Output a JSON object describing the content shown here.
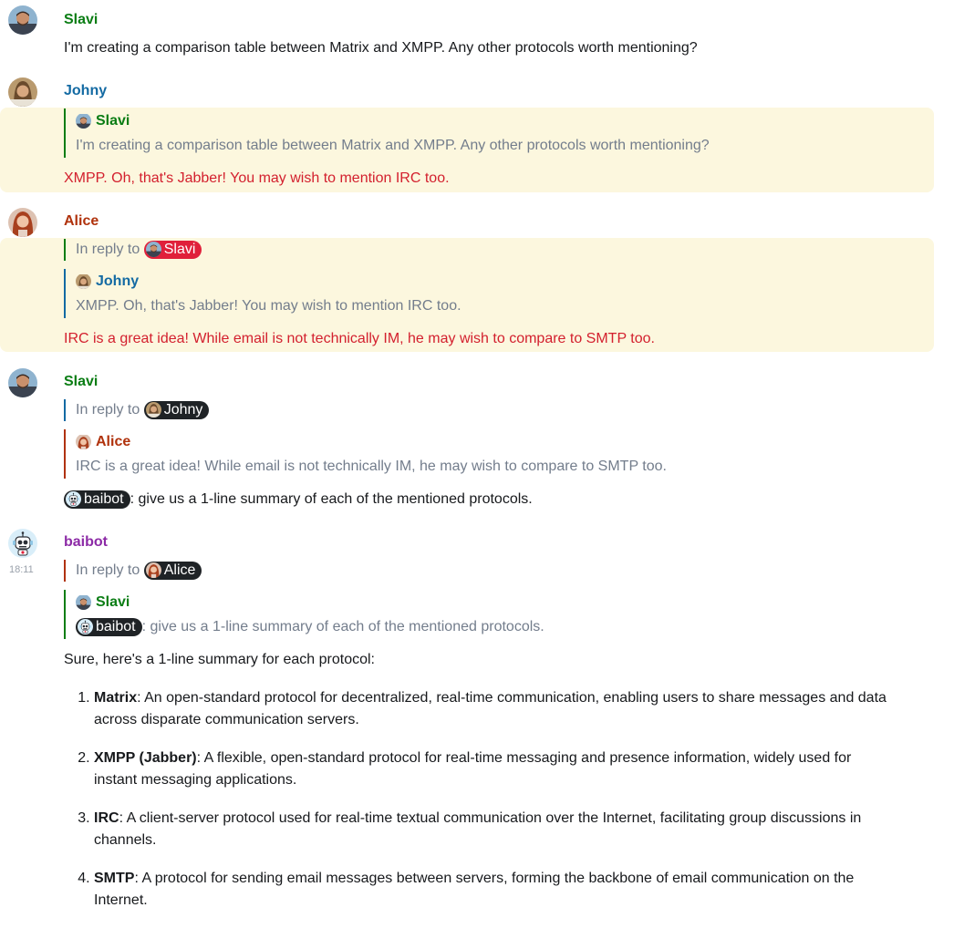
{
  "colors": {
    "highlight_bg": "#fcf7de",
    "mention_text": "#d3202e",
    "slavi": "#0a7d14",
    "johny": "#136aa3",
    "alice": "#b0320c",
    "baibot": "#8c2aa6"
  },
  "labels": {
    "in_reply_to": "In reply to"
  },
  "messages": [
    {
      "sender": "Slavi",
      "avatar": "slavi-avatar",
      "body": "I'm creating a comparison table between Matrix and XMPP. Any other protocols worth mentioning?"
    },
    {
      "sender": "Johny",
      "avatar": "johny-avatar",
      "quote_sender": "Slavi",
      "quote_body": "I'm creating a comparison table between Matrix and XMPP. Any other protocols worth mentioning?",
      "body": "XMPP. Oh, that's Jabber! You may wish to mention IRC too."
    },
    {
      "sender": "Alice",
      "avatar": "alice-avatar",
      "reply_to": "Slavi",
      "quote_sender": "Johny",
      "quote_body": "XMPP. Oh, that's Jabber! You may wish to mention IRC too.",
      "body": "IRC is a great idea! While email is not technically IM, he may wish to compare to SMTP too."
    },
    {
      "sender": "Slavi",
      "avatar": "slavi-avatar",
      "reply_to": "Johny",
      "quote_sender": "Alice",
      "quote_body": "IRC is a great idea! While email is not technically IM, he may wish to compare to SMTP too.",
      "mention": "baibot",
      "body": ": give us a 1-line summary of each of the mentioned protocols."
    },
    {
      "sender": "baibot",
      "avatar": "robot-avatar",
      "timestamp": "18:11",
      "reply_to": "Alice",
      "quote_sender": "Slavi",
      "quote_mention": "baibot",
      "quote_body": ": give us a 1-line summary of each of the mentioned protocols.",
      "intro": "Sure, here's a 1-line summary for each protocol:",
      "items": [
        {
          "term": "Matrix",
          "text": ": An open-standard protocol for decentralized, real-time communication, enabling users to share messages and data across disparate communication servers."
        },
        {
          "term": "XMPP (Jabber)",
          "text": ": A flexible, open-standard protocol for real-time messaging and presence information, widely used for instant messaging applications."
        },
        {
          "term": "IRC",
          "text": ": A client-server protocol used for real-time textual communication over the Internet, facilitating group discussions in channels."
        },
        {
          "term": "SMTP",
          "text": ": A protocol for sending email messages between servers, forming the backbone of email communication on the Internet."
        }
      ]
    }
  ]
}
